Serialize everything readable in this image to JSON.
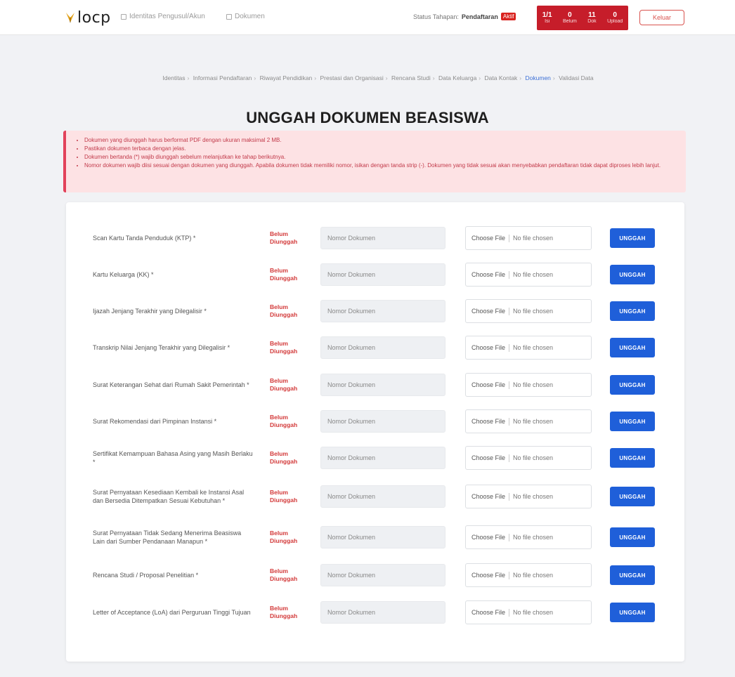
{
  "nav": {
    "logo_text": "locp",
    "link_1": "Identitas Pengusul/Akun",
    "link_2": "Dokumen",
    "status_prefix": "Status Tahapan:",
    "status_value": "Pendaftaran",
    "status_badge": "Aktif",
    "stats": [
      {
        "num": "1/1",
        "lbl": "Isi"
      },
      {
        "num": "0",
        "lbl": "Belum"
      },
      {
        "num": "11",
        "lbl": "Dok"
      },
      {
        "num": "0",
        "lbl": "Upload"
      }
    ],
    "logout_label": "Keluar",
    "accent_color": "#c61d2a"
  },
  "breadcrumb": {
    "items": [
      "Identitas",
      "Informasi Pendaftaran",
      "Riwayat Pendidikan",
      "Prestasi dan Organisasi",
      "Rencana Studi",
      "Data Keluarga",
      "Data Kontak"
    ],
    "active": "Dokumen",
    "last": "Validasi Data"
  },
  "page_title": "UNGGAH DOKUMEN BEASISWA",
  "alert": {
    "items": [
      "Dokumen yang diunggah harus berformat PDF dengan ukuran maksimal 2 MB.",
      "Pastikan dokumen terbaca dengan jelas.",
      "Dokumen bertanda (*) wajib diunggah sebelum melanjutkan ke tahap berikutnya.",
      "Nomor dokumen wajib diisi sesuai dengan dokumen yang diunggah. Apabila dokumen tidak memiliki nomor, isikan dengan tanda strip (-). Dokumen yang tidak sesuai akan menyebabkan pendaftaran tidak dapat diproses lebih lanjut."
    ],
    "color": "#c23a4a"
  },
  "documents": {
    "status_text": "Belum Diunggah",
    "number_placeholder": "Nomor Dokumen",
    "choose_file": "Choose File",
    "no_file": "No file chosen",
    "upload_label": "UNGGAH",
    "rows": [
      {
        "label": "Scan Kartu Tanda Penduduk (KTP) *"
      },
      {
        "label": "Kartu Keluarga (KK) *"
      },
      {
        "label": "Ijazah Jenjang Terakhir yang Dilegalisir *"
      },
      {
        "label": "Transkrip Nilai Jenjang Terakhir yang Dilegalisir *"
      },
      {
        "label": "Surat Keterangan Sehat dari Rumah Sakit Pemerintah *"
      },
      {
        "label": "Surat Rekomendasi dari Pimpinan Instansi *"
      },
      {
        "label": "Sertifikat Kemampuan Bahasa Asing yang Masih Berlaku *"
      },
      {
        "label": "Surat Pernyataan Kesediaan Kembali ke Instansi Asal dan Bersedia Ditempatkan Sesuai Kebutuhan *"
      },
      {
        "label": "Surat Pernyataan Tidak Sedang Menerima Beasiswa Lain dari Sumber Pendanaan Manapun *"
      },
      {
        "label": "Rencana Studi / Proposal Penelitian *"
      },
      {
        "label": "Letter of Acceptance (LoA) dari Perguruan Tinggi Tujuan"
      }
    ],
    "button_color": "#1f5fd9"
  }
}
